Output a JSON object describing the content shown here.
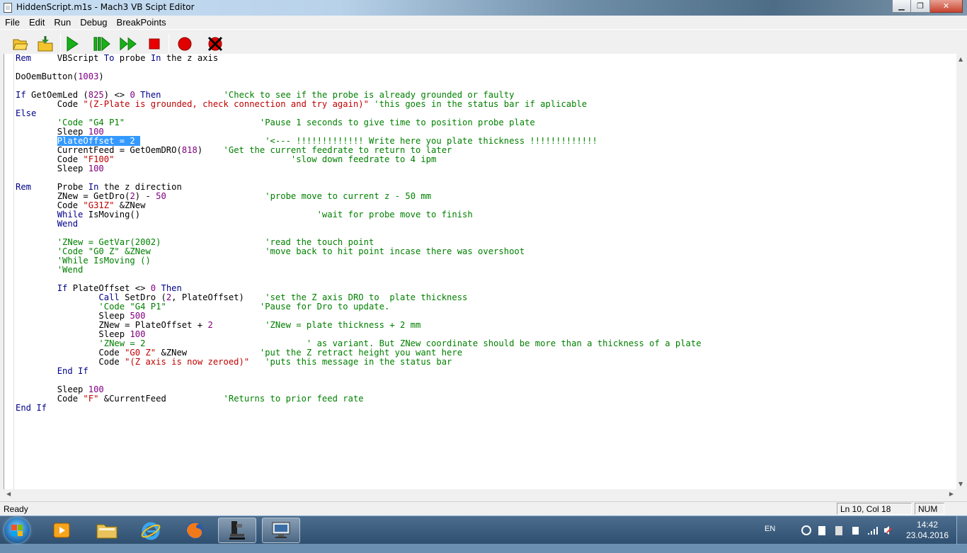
{
  "window": {
    "title": "HiddenScript.m1s - Mach3 VB Scipt Editor",
    "controls": [
      "minimize",
      "maximize",
      "close"
    ]
  },
  "menu": [
    "File",
    "Edit",
    "Run",
    "Debug",
    "BreakPoints"
  ],
  "toolbar": {
    "icons": [
      "open-folder-icon",
      "save-icon",
      "run-icon",
      "step-icon",
      "run-fast-icon",
      "stop-icon",
      "breakpoint-icon",
      "clear-breakpoints-icon"
    ]
  },
  "editor": {
    "lines": [
      [
        [
          "kw",
          "Rem"
        ],
        [
          "",
          "     VBScript "
        ],
        [
          "kw",
          "To"
        ],
        [
          "",
          " probe "
        ],
        [
          "kw",
          "In"
        ],
        [
          "",
          " the z axis"
        ]
      ],
      [],
      [
        [
          "",
          "DoOemButton("
        ],
        [
          "num",
          "1003"
        ],
        [
          "",
          ")"
        ]
      ],
      [],
      [
        [
          "kw",
          "If"
        ],
        [
          "",
          " GetOemLed ("
        ],
        [
          "num",
          "825"
        ],
        [
          "",
          ") <> "
        ],
        [
          "num",
          "0"
        ],
        [
          "",
          " "
        ],
        [
          "kw",
          "Then"
        ],
        [
          "",
          "            "
        ],
        [
          "cmt",
          "'Check to see if the probe is already grounded or faulty"
        ]
      ],
      [
        [
          "",
          "        Code "
        ],
        [
          "str",
          "\"(Z-Plate is grounded, check connection and try again)\""
        ],
        [
          "",
          " "
        ],
        [
          "cmt",
          "'this goes in the status bar if aplicable"
        ]
      ],
      [
        [
          "kw",
          "Else"
        ]
      ],
      [
        [
          "",
          "        "
        ],
        [
          "cmt",
          "'Code \"G4 P1\"                          'Pause 1 seconds to give time to position probe plate"
        ]
      ],
      [
        [
          "",
          "        Sleep "
        ],
        [
          "num",
          "100"
        ]
      ],
      [
        [
          "",
          "        "
        ],
        [
          "sel",
          "PlateOffset = 2 "
        ],
        [
          "",
          "                        "
        ],
        [
          "cmt",
          "'<--- !!!!!!!!!!!!! Write here you plate thickness !!!!!!!!!!!!!"
        ]
      ],
      [
        [
          "",
          "        CurrentFeed = GetOemDRO("
        ],
        [
          "num",
          "818"
        ],
        [
          "",
          ")    "
        ],
        [
          "cmt",
          "'Get the current feedrate to return to later"
        ]
      ],
      [
        [
          "",
          "        Code "
        ],
        [
          "str",
          "\"F100\""
        ],
        [
          "",
          "                                  "
        ],
        [
          "cmt",
          "'slow down feedrate to 4 ipm"
        ]
      ],
      [
        [
          "",
          "        Sleep "
        ],
        [
          "num",
          "100"
        ]
      ],
      [],
      [
        [
          "kw",
          "Rem"
        ],
        [
          "",
          "     Probe "
        ],
        [
          "kw",
          "In"
        ],
        [
          "",
          " the z direction"
        ]
      ],
      [
        [
          "",
          "        ZNew = GetDro("
        ],
        [
          "num",
          "2"
        ],
        [
          "",
          ") - "
        ],
        [
          "num",
          "50"
        ],
        [
          "",
          "                   "
        ],
        [
          "cmt",
          "'probe move to current z - 50 mm"
        ]
      ],
      [
        [
          "",
          "        Code "
        ],
        [
          "str",
          "\"G31Z\""
        ],
        [
          "",
          " &ZNew"
        ]
      ],
      [
        [
          "",
          "        "
        ],
        [
          "kw",
          "While"
        ],
        [
          "",
          " IsMoving()                                  "
        ],
        [
          "cmt",
          "'wait for probe move to finish"
        ]
      ],
      [
        [
          "",
          "        "
        ],
        [
          "kw",
          "Wend"
        ]
      ],
      [],
      [
        [
          "",
          "        "
        ],
        [
          "cmt",
          "'ZNew = GetVar(2002)                    'read the touch point"
        ]
      ],
      [
        [
          "",
          "        "
        ],
        [
          "cmt",
          "'Code \"G0 Z\" &ZNew                      'move back to hit point incase there was overshoot"
        ]
      ],
      [
        [
          "",
          "        "
        ],
        [
          "cmt",
          "'While IsMoving ()"
        ]
      ],
      [
        [
          "",
          "        "
        ],
        [
          "cmt",
          "'Wend"
        ]
      ],
      [],
      [
        [
          "",
          "        "
        ],
        [
          "kw",
          "If"
        ],
        [
          "",
          " PlateOffset <> "
        ],
        [
          "num",
          "0"
        ],
        [
          "",
          " "
        ],
        [
          "kw",
          "Then"
        ]
      ],
      [
        [
          "",
          "                "
        ],
        [
          "kw",
          "Call"
        ],
        [
          "",
          " SetDro ("
        ],
        [
          "num",
          "2"
        ],
        [
          "",
          ", PlateOffset)    "
        ],
        [
          "cmt",
          "'set the Z axis DRO to  plate thickness"
        ]
      ],
      [
        [
          "",
          "                "
        ],
        [
          "cmt",
          "'Code \"G4 P1\"                  'Pause for Dro to update."
        ]
      ],
      [
        [
          "",
          "                Sleep "
        ],
        [
          "num",
          "500"
        ]
      ],
      [
        [
          "",
          "                ZNew = PlateOffset + "
        ],
        [
          "num",
          "2"
        ],
        [
          "",
          "          "
        ],
        [
          "cmt",
          "'ZNew = plate thickness + 2 mm"
        ]
      ],
      [
        [
          "",
          "                Sleep "
        ],
        [
          "num",
          "100"
        ]
      ],
      [
        [
          "",
          "                "
        ],
        [
          "cmt",
          "'ZNew = 2                               ' as variant. But ZNew coordinate should be more than a thickness of a plate"
        ]
      ],
      [
        [
          "",
          "                Code "
        ],
        [
          "str",
          "\"G0 Z\""
        ],
        [
          "",
          " &ZNew              "
        ],
        [
          "cmt",
          "'put the Z retract height you want here"
        ]
      ],
      [
        [
          "",
          "                Code "
        ],
        [
          "str",
          "\"(Z axis is now zeroed)\""
        ],
        [
          "",
          "   "
        ],
        [
          "cmt",
          "'puts this message in the status bar"
        ]
      ],
      [
        [
          "",
          "        "
        ],
        [
          "kw",
          "End If"
        ]
      ],
      [],
      [
        [
          "",
          "        Sleep "
        ],
        [
          "num",
          "100"
        ]
      ],
      [
        [
          "",
          "        Code "
        ],
        [
          "str",
          "\"F\""
        ],
        [
          "",
          " &CurrentFeed           "
        ],
        [
          "cmt",
          "'Returns to prior feed rate"
        ]
      ],
      [
        [
          "kw",
          "End If"
        ]
      ]
    ]
  },
  "status": {
    "ready": "Ready",
    "position": "Ln 10, Col 18",
    "num": "NUM"
  },
  "taskbar": {
    "apps": [
      "media-player-icon",
      "file-explorer-icon",
      "internet-explorer-icon",
      "firefox-icon",
      "mach3-icon",
      "remote-desktop-icon"
    ],
    "language": "EN",
    "time": "14:42",
    "date": "23.04.2016"
  }
}
